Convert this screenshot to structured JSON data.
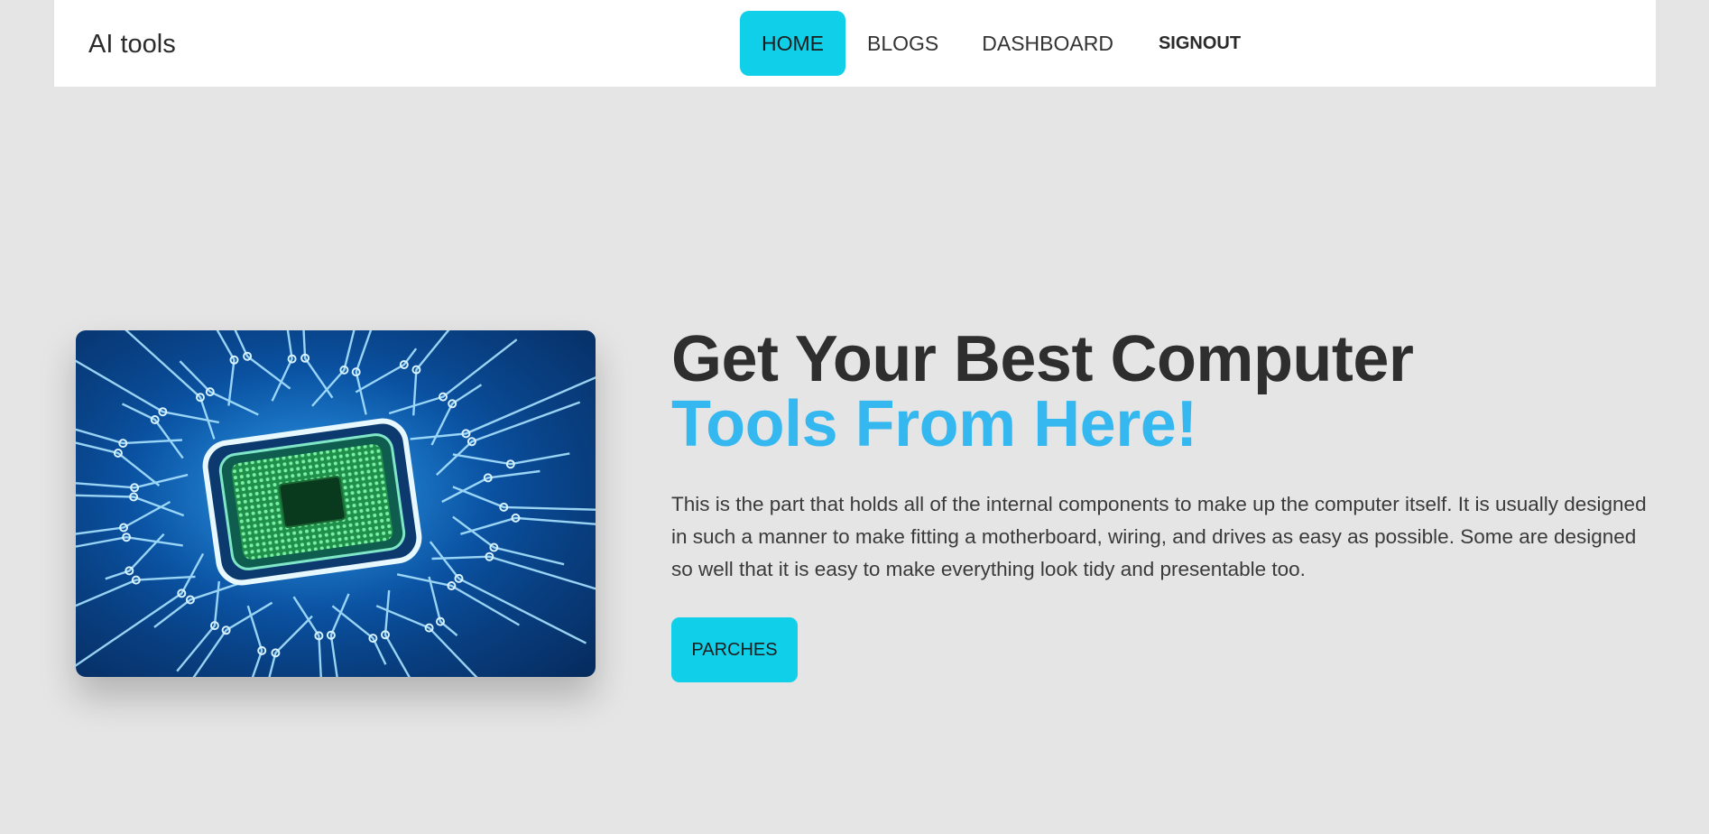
{
  "brand": {
    "name": "AI tools"
  },
  "nav": {
    "home": "HOME",
    "blogs": "BLOGS",
    "dashboard": "DASHBOARD",
    "signout": "SIGNOUT",
    "active": "HOME"
  },
  "hero": {
    "image": {
      "icon": "circuit-chip-image"
    },
    "title_line1": "Get Your Best Computer",
    "title_line2": "Tools From Here!",
    "description": "This is the part that holds all of the internal components to make up the computer itself. It is usually designed in such a manner to make fitting a motherboard, wiring, and drives as easy as possible. Some are designed so well that it is easy to make everything look tidy and presentable too.",
    "cta_label": "PARCHES"
  },
  "colors": {
    "page_background": "#e5e5e5",
    "navbar_background": "#ffffff",
    "accent": "#10cfe9",
    "headline_highlight": "#35b8ef",
    "text": "#2e2e2e"
  }
}
